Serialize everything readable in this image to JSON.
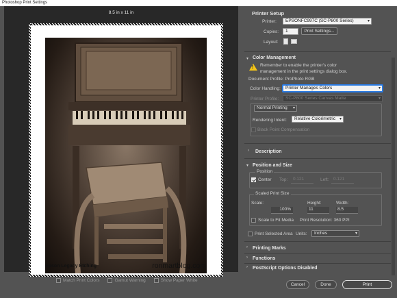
{
  "window": {
    "title": "Photoshop Print Settings"
  },
  "preview": {
    "page_size": "8.5 in x 11 in",
    "caption_left": "Epson Legacy Etching",
    "caption_right": "ronmartblog.com"
  },
  "preview_options": {
    "match_print_colors": "Match Print Colors",
    "gamut_warning": "Gamut Warning",
    "show_paper_white": "Show Paper White"
  },
  "printer_setup": {
    "heading": "Printer Setup",
    "printer_label": "Printer:",
    "printer_value": "EPSONFC997C (SC-P800 Series)",
    "copies_label": "Copies:",
    "copies_value": "1",
    "print_settings_button": "Print Settings...",
    "layout_label": "Layout:"
  },
  "color_management": {
    "heading": "Color Management",
    "warning_text": "Remember to enable the printer's color management in the print settings dialog box.",
    "document_profile": "Document Profile: ProPhoto RGB",
    "color_handling_label": "Color Handling:",
    "color_handling_value": "Printer Manages Colors",
    "printer_profile_label": "Printer Profile:",
    "printer_profile_value": "SC-P800 Series Canvas Matte",
    "printing_mode": "Normal Printing",
    "rendering_intent_label": "Rendering Intent:",
    "rendering_intent_value": "Relative Colorimetric",
    "black_point": "Black Point Compensation"
  },
  "description": {
    "heading": "Description"
  },
  "position_size": {
    "heading": "Position and Size",
    "position_label": "Position",
    "center_label": "Center",
    "top_label": "Top:",
    "top_value": "0.121",
    "left_label": "Left:",
    "left_value": "0.121",
    "scaled_label": "Scaled Print Size",
    "scale_label": "Scale:",
    "scale_value": "100%",
    "height_label": "Height:",
    "height_value": "11",
    "width_label": "Width:",
    "width_value": "8.5",
    "scale_to_fit": "Scale to Fit Media",
    "print_resolution": "Print Resolution: 360 PPI"
  },
  "selected_area": {
    "label": "Print Selected Area",
    "units_label": "Units:",
    "units_value": "Inches"
  },
  "sections": {
    "printing_marks": "Printing Marks",
    "functions": "Functions",
    "postscript": "PostScript Options Disabled"
  },
  "buttons": {
    "cancel": "Cancel",
    "done": "Done",
    "print": "Print"
  },
  "colors": {
    "accent": "#2a7ae2",
    "warning": "#f5c518"
  }
}
